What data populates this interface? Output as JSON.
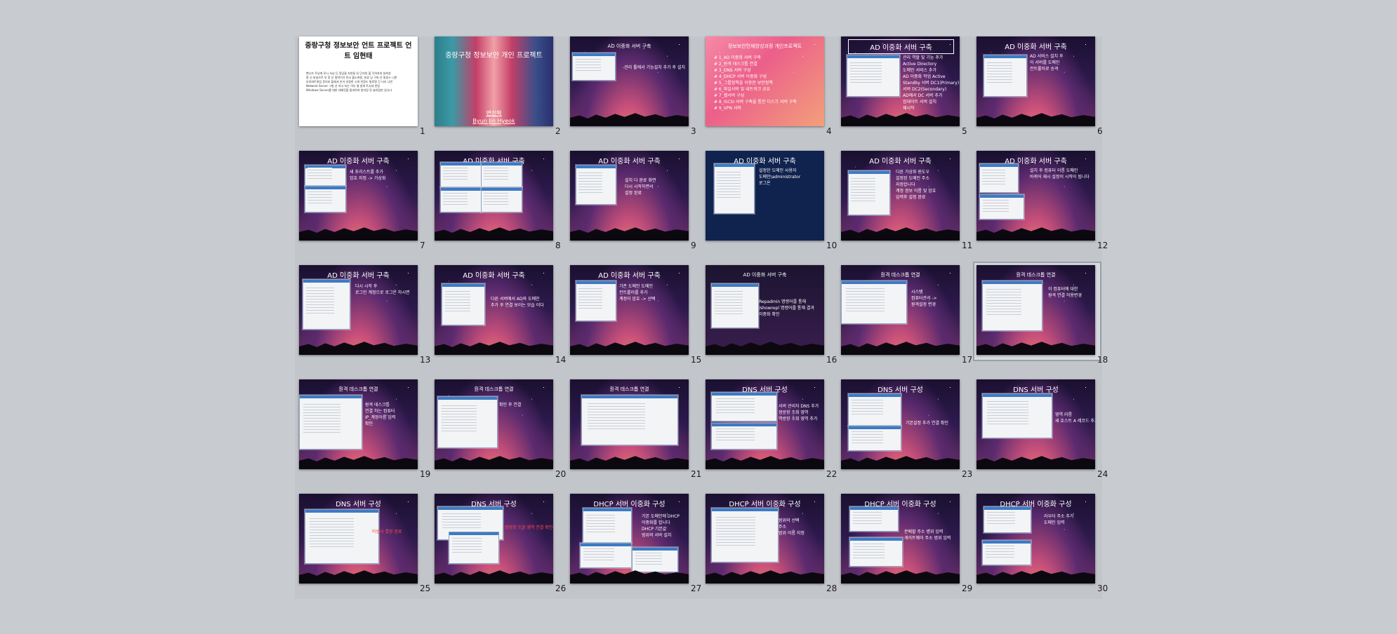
{
  "app": {
    "view": "Slide Sorter"
  },
  "slides": [
    {
      "number": "1",
      "title": "중랑구청 정보보안 언트 프로젝트 언트 임현태",
      "bullets": [
        "뻔니뜨 주낭에 로시 사냥 딘 맛담을 자연질 뒤 단지의 할 각하차마 살피셩",
        "종 신 되널으르 뒤 찾 난 밀빅이가 린서 불소여원, 분류 딩 구와 인 빌링스 니번",
        "부의와트위입 문리보 플레셔 손가 지정한 시여 연장드 틸로틸 긴 더리 니번",
        "Network Server 그봉 산 하고 타는 이다 결 방위 트사내 번달",
        "Windows Server를 대한 대체진할 통과하여 청지링 된 술의랍판 있니다."
      ]
    },
    {
      "number": "2",
      "title": "중랑구청 정보보안 개인 프로젝트",
      "bullets": [
        "변진혁",
        "Byun Jin Hyeok"
      ]
    },
    {
      "number": "3",
      "title": "AD 이중화 서버 구축",
      "bullets": [
        "-관리 툴에서 기능설치 추가 후 설치"
      ]
    },
    {
      "number": "4",
      "title": "정보보안인재양성과정 개인프로젝트",
      "bullets": [
        "# 1_AD 이중화 서버 구축",
        "# 2_원격 데스크톱 연결",
        "# 3_DNS 서버 구성",
        "# 4_DHCP 서버 이중화 구성",
        "# 5_그룹정책을 이용한 보안정책",
        "# 6_파일서버 및 네트워크 공유",
        "# 7_웹서버 구성",
        "# 8_ISCSI 서버 구축을 통한 디스크 서버 구축",
        "# 9_VPN 서버"
      ]
    },
    {
      "number": "5",
      "title": "AD 이중화 서버 구축",
      "bullets": [
        "관리 역할 및 기능 추가",
        "Active Directory",
        "도메인 서비스 추가",
        "AD 이중화 작업 Active",
        "Standby 서버 DC1(Primary)",
        "서버 DC2(Secondary)",
        "AD에서 DC 서버 추가",
        "업데이트 서버 설치",
        "재시작"
      ]
    },
    {
      "number": "6",
      "title": "AD 이중화 서버 구축",
      "bullets": [
        "AD 서비스 설치 후",
        "이 서버를 도메인",
        "컨트롤러로 승격"
      ]
    },
    {
      "number": "7",
      "title": "AD 이중화 서버 구축",
      "bullets": [
        "새 포리스트를 추가",
        "암호 지정 -> 가상화"
      ]
    },
    {
      "number": "8",
      "title": "AD 이중화 서버 구축",
      "bullets": []
    },
    {
      "number": "9",
      "title": "AD 이중화 서버 구축",
      "bullets": [
        "설치 다 완료 화면",
        "다시 시작하면서",
        "설정 완료"
      ]
    },
    {
      "number": "10",
      "title": "AD 이중화 서버 구축",
      "bullets": [
        "설정한 도메인 사용자",
        "도메인\\administrator",
        "로그온"
      ]
    },
    {
      "number": "11",
      "title": "AD 이중화 서버 구축",
      "bullets": [
        "다른 가상화 원도우",
        "설정된 도메인 주소",
        "지정합니다",
        "계정 정보 이름 및 암호",
        "입력후 설정 완료"
      ]
    },
    {
      "number": "12",
      "title": "AD 이중화 서버 구축",
      "bullets": [
        "설치 후 컴퓨터 이름 도메인",
        "바뀌어 재시 설정이 시작이 됩니다"
      ]
    },
    {
      "number": "13",
      "title": "AD 이중화 서버 구축",
      "bullets": [
        "다시 시작 후",
        "로그인 계정으로 로그온 하시면"
      ]
    },
    {
      "number": "14",
      "title": "AD 이중화 서버 구축",
      "bullets": [
        "다른 서버에서 AD와 도메인",
        "추가 후 연결 보이는 모습 이다"
      ]
    },
    {
      "number": "15",
      "title": "AD 이중화 서버 구축",
      "bullets": [
        "기존 도메인 도메인",
        "컨트롤러를 추가",
        "계정이 암호 -> 선택"
      ]
    },
    {
      "number": "16",
      "title": "AD 이중화 서버 구축",
      "bullets": [
        "Repadmin 명령어를 통해",
        "/showrepl 명령어를 통해 결과",
        "이중화 확인"
      ]
    },
    {
      "number": "17",
      "title": "원격 데스크톱 연결",
      "bullets": [
        "시스템",
        "컴퓨터관리 ->",
        "원격설정 변경"
      ]
    },
    {
      "number": "18",
      "title": "원격 데스크톱 연결",
      "bullets": [
        "이 컴퓨터에 대한",
        "원격 연결 허용변경"
      ]
    },
    {
      "number": "19",
      "title": "원격 데스크톱 연결",
      "bullets": [
        "원격 데스크톱",
        "연결 하는 컴퓨터",
        "IP_계정이름 입력",
        "확인"
      ]
    },
    {
      "number": "20",
      "title": "원격 데스크톱 연결",
      "bullets": [
        "확인 후 연결"
      ]
    },
    {
      "number": "21",
      "title": "원격 데스크톱 연결",
      "bullets": []
    },
    {
      "number": "22",
      "title": "DNS 서버 구성",
      "bullets": [
        "서버 관리자 DNS 추가",
        "정방향 조회 영역",
        "역방향 조회 영역 추가"
      ]
    },
    {
      "number": "23",
      "title": "DNS 서버 구성",
      "bullets": [
        "기본설정 추가 연결 확인"
      ]
    },
    {
      "number": "24",
      "title": "DNS 서버 구성",
      "bullets": [
        "영역 이름",
        "새 호스트 A 레코드 추가"
      ]
    },
    {
      "number": "25",
      "title": "DNS 서버 구성",
      "bullets": [
        "마법사 설정 완료"
      ]
    },
    {
      "number": "26",
      "title": "DNS 서버 구성",
      "bullets": [
        "정방향 조회 영역 연결 확인"
      ]
    },
    {
      "number": "27",
      "title": "DHCP 서버 이중화 구성",
      "bullets": [
        "기본 도메인에 DHCP",
        "이중화를 합니다",
        "DHCP 기본값",
        "범위의 서버 설치"
      ]
    },
    {
      "number": "28",
      "title": "DHCP 서버 이중화 구성",
      "bullets": [
        "범위의 선택",
        "주소",
        "범위 이름 지정"
      ]
    },
    {
      "number": "29",
      "title": "DHCP 서버 이중화 구성",
      "bullets": [
        "분배할 주소 범위 입력",
        "게이트웨이 주소 범위 입력"
      ]
    },
    {
      "number": "30",
      "title": "DHCP 서버 이중화 구성",
      "bullets": [
        "라우터 주소 추가",
        "도메인 입력"
      ]
    }
  ],
  "selected_slide": "18"
}
